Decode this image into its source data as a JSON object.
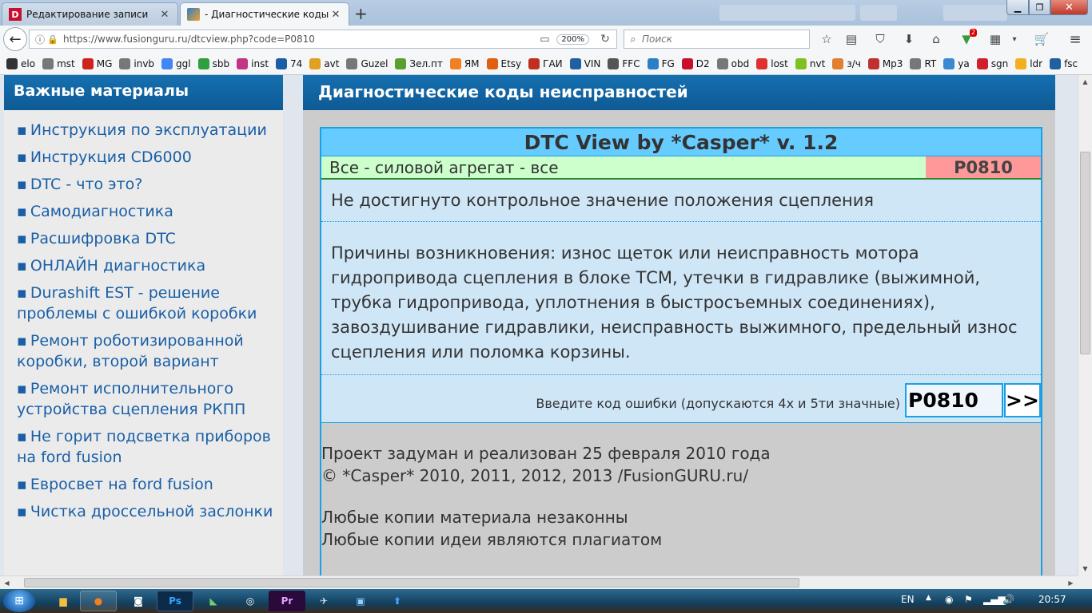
{
  "tabs": [
    {
      "title": "Редактирование записи",
      "icon": "d-icon",
      "active": false
    },
    {
      "title": "- Диагностические коды неисправностей",
      "icon": "fusionguru-icon",
      "active": true
    }
  ],
  "navbar": {
    "url": "https://www.fusionguru.ru/dtcview.php?code=P0810",
    "zoom": "200%",
    "search_placeholder": "Поиск",
    "notif_badge": "2"
  },
  "bookmarks": [
    {
      "label": "elo",
      "color": "#333333"
    },
    {
      "label": "mst",
      "color": "#777777"
    },
    {
      "label": "MG",
      "color": "#d02020"
    },
    {
      "label": "invb",
      "color": "#777777"
    },
    {
      "label": "ggl",
      "color": "#4285f4"
    },
    {
      "label": "sbb",
      "color": "#2e9e3e"
    },
    {
      "label": "inst",
      "color": "#c13584"
    },
    {
      "label": "74",
      "color": "#1a5fa6"
    },
    {
      "label": "avt",
      "color": "#e0a020"
    },
    {
      "label": "Guzel",
      "color": "#777777"
    },
    {
      "label": "Зел.пт",
      "color": "#5aa02c"
    },
    {
      "label": "ЯМ",
      "color": "#f08020"
    },
    {
      "label": "Etsy",
      "color": "#e06010"
    },
    {
      "label": "ГАИ",
      "color": "#c03020"
    },
    {
      "label": "VIN",
      "color": "#2060a0"
    },
    {
      "label": "FFC",
      "color": "#555555"
    },
    {
      "label": "FG",
      "color": "#2a7fc6"
    },
    {
      "label": "D2",
      "color": "#c8102e"
    },
    {
      "label": "obd",
      "color": "#777777"
    },
    {
      "label": "lost",
      "color": "#e03030"
    },
    {
      "label": "nvt",
      "color": "#80c020"
    },
    {
      "label": "з/ч",
      "color": "#e08030"
    },
    {
      "label": "Mp3",
      "color": "#c03030"
    },
    {
      "label": "RT",
      "color": "#777777"
    },
    {
      "label": "ya",
      "color": "#3a8ad0"
    },
    {
      "label": "sgn",
      "color": "#d02030"
    },
    {
      "label": "ldr",
      "color": "#f0b020"
    },
    {
      "label": "fsc",
      "color": "#2060a0"
    }
  ],
  "sidebar": {
    "heading": "Важные материалы",
    "bullet": "▪",
    "items": [
      "Инструкция по эксплуатации",
      "Инструкция CD6000",
      "DTC - что это?",
      "Самодиагностика",
      "Расшифровка DTC",
      "ОНЛАЙН диагностика",
      "Durashift EST - решение проблемы с ошибкой коробки",
      "Ремонт роботизированной коробки, второй вариант",
      "Ремонт исполнительного устройства сцепления РКПП",
      "Не горит подсветка приборов на ford fusion",
      "Евросвет на ford fusion",
      "Чистка дроссельной заслонки"
    ]
  },
  "main": {
    "heading": "Диагностические коды неисправностей",
    "dtc": {
      "title": "DTC View by *Casper* v. 1.2",
      "category": "Все - силовой агрегат - все",
      "code": "P0810",
      "description": "Не достигнуто контрольное значение положения сцепления",
      "causes": "Причины возникновения: износ щеток или неисправность мотора гидропривода сцепления в блоке ТСМ, утечки в гидравлике (выжимной, трубка гидропривода, уплотнения в быстросъемных соединениях), завоздушивание гидравлики, неисправность выжимного, предельный износ сцепления или поломка корзины.",
      "input_label": "Введите код ошибки (допускаются 4х и 5ти значные)",
      "input_value": "P0810",
      "submit_label": ">>"
    },
    "footer": {
      "line1": "Проект задуман и реализован 25 февраля 2010 года",
      "line2": "© *Casper* 2010, 2011, 2012, 2013 /FusionGURU.ru/",
      "line3": "Любые копии материала незаконны",
      "line4": "Любые копии идеи являются плагиатом"
    }
  },
  "taskbar": {
    "lang": "EN",
    "time": "20:57",
    "apps": [
      "explorer",
      "firefox",
      "app-1",
      "Ps",
      "app-2",
      "app-3",
      "Pr",
      "app-4",
      "app-5",
      "app-6"
    ]
  }
}
